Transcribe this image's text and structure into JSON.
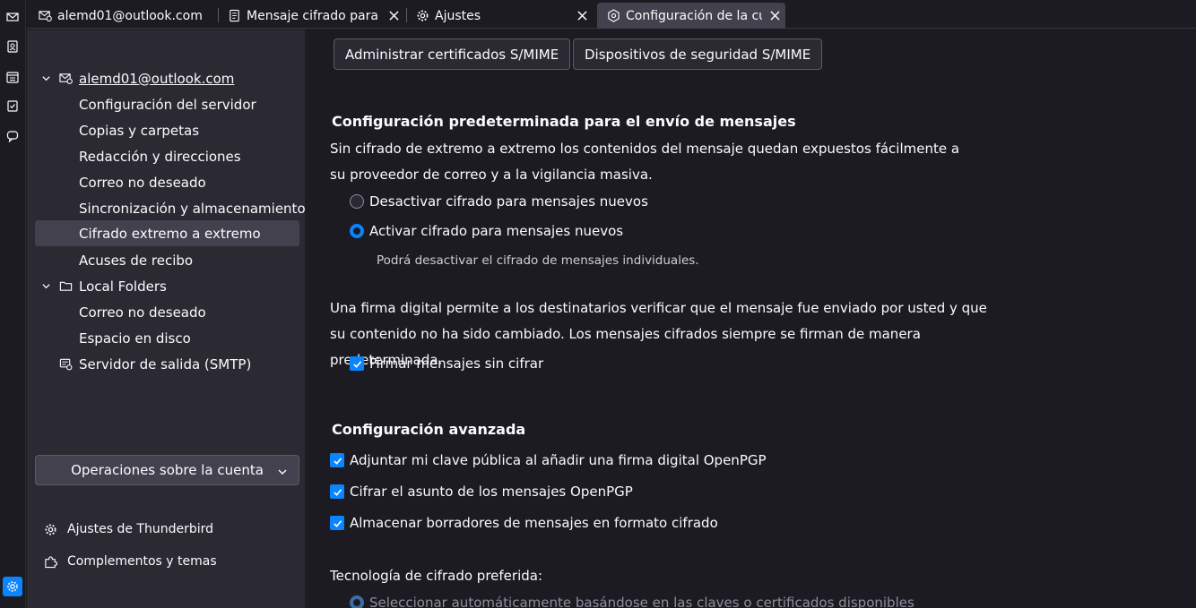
{
  "tabs": [
    {
      "label": "alemd01@outlook.com",
      "icon": "mail-account-icon"
    },
    {
      "label": "Mensaje cifrado para A",
      "icon": "document-icon"
    },
    {
      "label": "Ajustes",
      "icon": "gear-icon"
    },
    {
      "label": "Configuración de la cue",
      "icon": "account-settings-icon",
      "selected": true
    }
  ],
  "tree": {
    "account": "alemd01@outlook.com",
    "account_items": [
      "Configuración del servidor",
      "Copias y carpetas",
      "Redacción y direcciones",
      "Correo no deseado",
      "Sincronización y almacenamiento",
      "Cifrado extremo a extremo",
      "Acuses de recibo"
    ],
    "selected_item": "Cifrado extremo a extremo",
    "local": "Local Folders",
    "local_items": [
      "Correo no deseado",
      "Espacio en disco"
    ],
    "smtp": "Servidor de salida (SMTP)"
  },
  "account_ops": "Operaciones sobre la cuenta",
  "footer": {
    "settings": "Ajustes de Thunderbird",
    "addons": "Complementos y temas"
  },
  "main": {
    "btn_certs": "Administrar certificados S/MIME",
    "btn_devices": "Dispositivos de seguridad S/MIME",
    "default_heading": "Configuración predeterminada para el envío de mensajes",
    "default_desc": "Sin cifrado de extremo a extremo los contenidos del mensaje quedan expuestos fácilmente a su proveedor de correo y a la vigilancia masiva.",
    "radio_disable": "Desactivar cifrado para mensajes nuevos",
    "radio_enable": "Activar cifrado para mensajes nuevos",
    "radio_hint": "Podrá desactivar el cifrado de mensajes individuales.",
    "sign_desc": "Una firma digital permite a los destinatarios verificar que el mensaje fue enviado por usted y que su contenido no ha sido cambiado. Los mensajes cifrados siempre se firman de manera predeterminada.",
    "check_sign": "Firmar mensajes sin cifrar",
    "advanced_heading": "Configuración avanzada",
    "check_attach_key": "Adjuntar mi clave pública al añadir una firma digital OpenPGP",
    "check_encrypt_subject": "Cifrar el asunto de los mensajes OpenPGP",
    "check_drafts": "Almacenar borradores de mensajes en formato cifrado",
    "tech_label": "Tecnología de cifrado preferida:",
    "radio_auto": "Seleccionar automáticamente basándose en las claves o certificados disponibles"
  },
  "colors": {
    "accent": "#0a84ff",
    "sidebar_bg": "#2b2a33",
    "main_bg": "#1c1b22",
    "selected_bg": "#42414d"
  }
}
